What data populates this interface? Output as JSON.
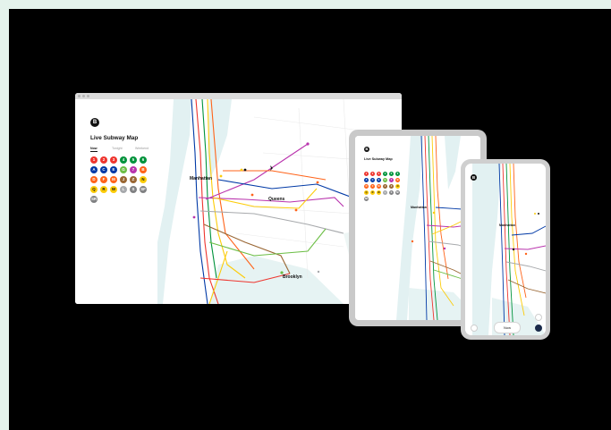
{
  "app": {
    "title": "Live Subway Map",
    "logo_text": "B"
  },
  "tabs": [
    {
      "label": "Now"
    },
    {
      "label": "Tonight"
    },
    {
      "label": "Weekend"
    }
  ],
  "map_labels": {
    "manhattan": "Manhattan",
    "queens": "Queens",
    "brooklyn": "Brooklyn"
  },
  "route_badges": [
    {
      "label": "1",
      "color": "#ee352e"
    },
    {
      "label": "2",
      "color": "#ee352e"
    },
    {
      "label": "3",
      "color": "#ee352e"
    },
    {
      "label": "4",
      "color": "#00933c"
    },
    {
      "label": "5",
      "color": "#00933c"
    },
    {
      "label": "6",
      "color": "#00933c"
    },
    {
      "label": "A",
      "color": "#0039a6"
    },
    {
      "label": "C",
      "color": "#0039a6"
    },
    {
      "label": "E",
      "color": "#0039a6"
    },
    {
      "label": "G",
      "color": "#6cbe45"
    },
    {
      "label": "7",
      "color": "#b933ad"
    },
    {
      "label": "B",
      "color": "#ff6319"
    },
    {
      "label": "D",
      "color": "#ff6319"
    },
    {
      "label": "F",
      "color": "#ff6319"
    },
    {
      "label": "M",
      "color": "#ff6319"
    },
    {
      "label": "J",
      "color": "#996633"
    },
    {
      "label": "Z",
      "color": "#996633"
    },
    {
      "label": "N",
      "color": "#fccc0a"
    },
    {
      "label": "Q",
      "color": "#fccc0a"
    },
    {
      "label": "R",
      "color": "#fccc0a"
    },
    {
      "label": "W",
      "color": "#fccc0a"
    },
    {
      "label": "L",
      "color": "#a7a9ac"
    },
    {
      "label": "S",
      "color": "#808183"
    },
    {
      "label": "SF",
      "color": "#808183"
    },
    {
      "label": "SR",
      "color": "#808183"
    }
  ],
  "phone": {
    "now_button": "Now"
  },
  "colors": {
    "background": "#e4f3ec",
    "stage": "#000000",
    "water": "#dff0f0",
    "land": "#ffffff"
  }
}
